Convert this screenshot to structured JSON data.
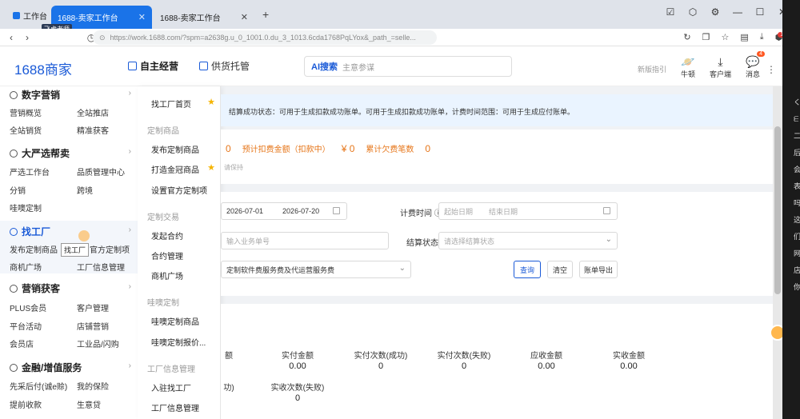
{
  "browser": {
    "tabs": [
      {
        "label": "工作台"
      },
      {
        "label": "1688-卖家工作台"
      },
      {
        "label": "1688-卖家工作台"
      }
    ],
    "url": "https://work.1688.com/?spm=a2638g.u_0_1001.0.du_3_1013.6cda1768PqLYox&_path_=selle...",
    "watermark": "飞虎老师",
    "ext_badge": "12"
  },
  "header": {
    "logo_num": "1688",
    "logo_text": "商家",
    "nav": [
      {
        "label": "自主经营"
      },
      {
        "label": "供货托管"
      }
    ],
    "search_ai": "AI搜索",
    "search_placeholder": "主意参谋",
    "guide": "新版指引",
    "actions": [
      {
        "label": "牛顿",
        "icon": "planet-icon"
      },
      {
        "label": "客户端",
        "icon": "download-icon"
      },
      {
        "label": "消息",
        "icon": "chat-icon",
        "badge": "4"
      }
    ]
  },
  "sidebar": {
    "sections": [
      {
        "title": "数字营销",
        "links": [
          "营销概览",
          "全站推店",
          "全站销货",
          "精准获客"
        ]
      },
      {
        "title": "大严选帮卖",
        "links": [
          "严选工作台",
          "品质管理中心",
          "分销",
          "跨境",
          "哇噢定制"
        ]
      },
      {
        "title": "找工厂",
        "links": [
          "发布定制商品",
          "官方定制项",
          "商机广场",
          "工厂信息管理"
        ]
      },
      {
        "title": "营销获客",
        "links": [
          "PLUS会员",
          "客户管理",
          "平台活动",
          "店铺营销",
          "会员店",
          "工业品/闪购"
        ]
      },
      {
        "title": "金融/增值服务",
        "links": [
          "先采后付(诚e赊)",
          "我的保险",
          "提前收款",
          "生意贷"
        ]
      }
    ],
    "tooltip": "找工厂"
  },
  "flyout": {
    "items": [
      {
        "label": "找工厂首页",
        "star": true
      },
      {
        "group": "定制商品"
      },
      {
        "label": "发布定制商品"
      },
      {
        "label": "打造金冠商品",
        "star": true
      },
      {
        "label": "设置官方定制项"
      },
      {
        "group": "定制交易"
      },
      {
        "label": "发起合约"
      },
      {
        "label": "合约管理"
      },
      {
        "label": "商机广场"
      },
      {
        "group": "哇噢定制"
      },
      {
        "label": "哇噢定制商品"
      },
      {
        "label": "哇噢定制报价..."
      },
      {
        "group": "工厂信息管理"
      },
      {
        "label": "入驻找工厂"
      },
      {
        "label": "工厂信息管理"
      }
    ]
  },
  "main": {
    "notice": "结算成功状态：可用于生成扣款成功账单。可用于生成扣款成功账单，计费时间范围：可用于生成应付账单。",
    "stats": {
      "v1": "0",
      "pre_label": "预计扣费金额（扣款中）",
      "pre_value": "¥ 0",
      "acc_label": "累计欠费笔数",
      "acc_value": "0",
      "note": "请保持"
    },
    "filters": {
      "date_start": "2026-07-01",
      "date_end": "2026-07-20",
      "bill_time_label": "计费时间",
      "bill_start_ph": "起始日期",
      "bill_end_ph": "结束日期",
      "biz_no_ph": "输入业务单号",
      "settle_label": "结算状态",
      "settle_ph": "请选择结算状态",
      "service_type": "定制软件费服务费及代运营服务费",
      "query": "查询",
      "clear": "清空",
      "export": "账单导出"
    },
    "summary": {
      "row1": [
        {
          "label": "实付金额",
          "value": "0.00"
        },
        {
          "label": "实付次数(成功)",
          "value": "0"
        },
        {
          "label": "实付次数(失败)",
          "value": "0"
        },
        {
          "label": "应收金额",
          "value": "0.00"
        },
        {
          "label": "实收金额",
          "value": "0.00"
        }
      ],
      "row1_lead": "额",
      "row2_lead": "功)",
      "row2": [
        {
          "label": "实收次数(失败)",
          "value": "0"
        }
      ]
    }
  },
  "edge_chars": [
    "く",
    "ᗴ",
    "二",
    "后",
    "会",
    "表",
    "吗",
    "这",
    "们",
    "网",
    "店",
    "你"
  ]
}
